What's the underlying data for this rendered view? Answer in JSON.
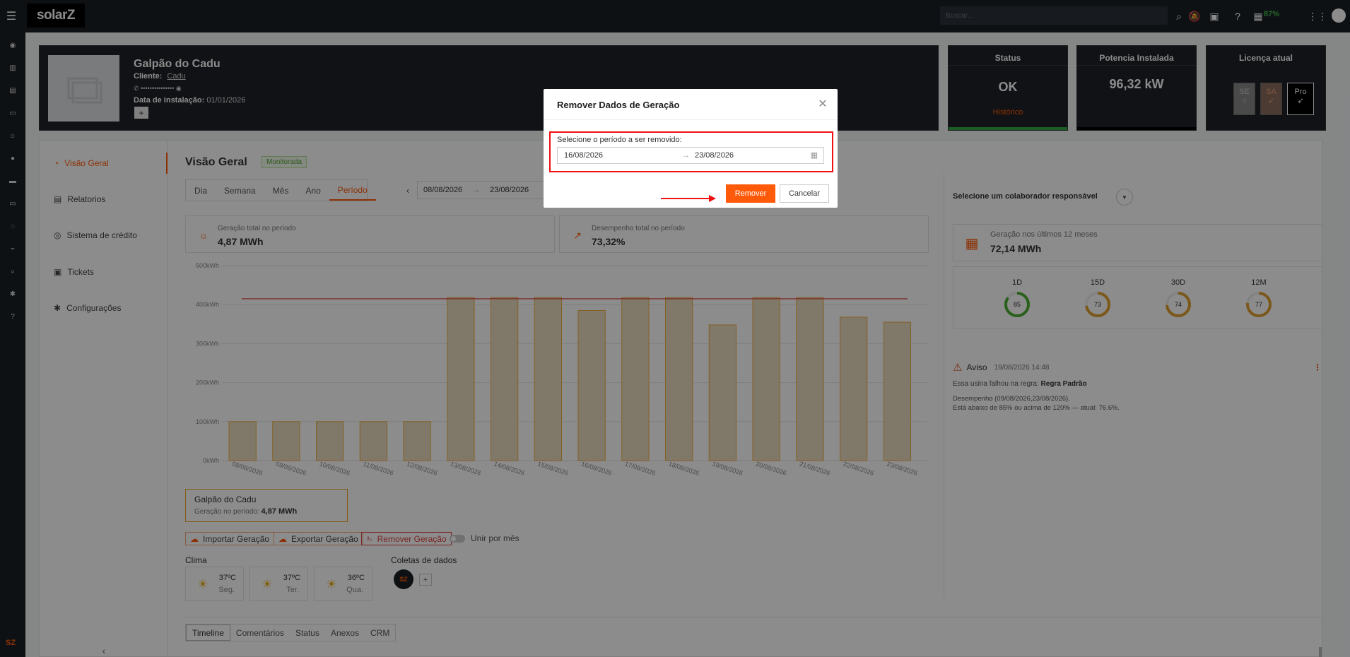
{
  "topbar": {
    "brand": "solarZ",
    "search_placeholder": "Buscar...",
    "battery": "87%"
  },
  "header": {
    "plant_name": "Galpão do Cadu",
    "client_label": "Cliente:",
    "client_name": "Cadu",
    "phone_masked": "•••••••••••••••",
    "install_label": "Data de instalação:",
    "install_date": "01/01/2026",
    "plus": "+"
  },
  "status_card": {
    "title": "Status",
    "value": "OK",
    "link": "Histórico"
  },
  "power_card": {
    "title": "Potencia Instalada",
    "value": "96,32 kW"
  },
  "license_card": {
    "title": "Licença atual",
    "items": [
      "SE",
      "SA",
      "Pro"
    ]
  },
  "nav": {
    "items": [
      {
        "label": "Visão Geral",
        "active": true
      },
      {
        "label": "Relatorios"
      },
      {
        "label": "Sistema de crédito"
      },
      {
        "label": "Tickets"
      },
      {
        "label": "Configurações"
      }
    ]
  },
  "overview": {
    "title": "Visão Geral",
    "badge": "Monitorada",
    "tabs": [
      "Dia",
      "Semana",
      "Mês",
      "Ano",
      "Período"
    ],
    "active_tab": "Período",
    "date_from": "08/08/2026",
    "date_to": "23/08/2026",
    "kpi_total_label": "Geração total no período",
    "kpi_total_value": "4,87 MWh",
    "kpi_perf_label": "Desempenho total no período",
    "kpi_perf_value": "73,32%"
  },
  "chart_data": {
    "type": "bar",
    "categories": [
      "08/08/2026",
      "09/08/2026",
      "10/08/2026",
      "11/08/2026",
      "12/08/2026",
      "13/08/2026",
      "14/08/2026",
      "15/08/2026",
      "16/08/2026",
      "17/08/2026",
      "18/08/2026",
      "19/08/2026",
      "20/08/2026",
      "21/08/2026",
      "22/08/2026",
      "23/08/2026"
    ],
    "values": [
      100,
      100,
      100,
      100,
      100,
      418,
      418,
      418,
      385,
      418,
      418,
      348,
      418,
      418,
      368,
      355
    ],
    "reference_line": 415,
    "yticks": [
      "0kWh",
      "100kWh",
      "200kWh",
      "300kWh",
      "400kWh",
      "500kWh"
    ],
    "ylim": [
      0,
      500
    ],
    "colors": {
      "bar_fill": "#e9dcc0",
      "bar_stroke": "#f0b040",
      "reference": "#e03030"
    }
  },
  "summary": {
    "title": "Galpão do Cadu",
    "label": "Geração no período:",
    "value": "4,87 MWh"
  },
  "actions": {
    "import": "Importar Geração",
    "export": "Exportar Geração",
    "remove": "Remover Geração",
    "merge": "Unir por mês"
  },
  "weather": {
    "title": "Clima",
    "days": [
      {
        "temp": "37ºC",
        "day": "Seg."
      },
      {
        "temp": "37ºC",
        "day": "Ter."
      },
      {
        "temp": "36ºC",
        "day": "Qua."
      }
    ]
  },
  "collections": {
    "title": "Coletas de dados",
    "logo": "SZ",
    "plus": "+"
  },
  "right": {
    "collaborator": "Selecione um colaborador responsável",
    "gen12_label": "Geração nos últimos 12 meses",
    "gen12_value": "72,14 MWh",
    "gauges": [
      {
        "label": "1D",
        "value": "85",
        "color": "#4caf32"
      },
      {
        "label": "15D",
        "value": "73",
        "color": "#e0a030"
      },
      {
        "label": "30D",
        "value": "74",
        "color": "#e0a030"
      },
      {
        "label": "12M",
        "value": "77",
        "color": "#e0a030"
      }
    ],
    "warning_title": "Aviso",
    "warning_date": "19/08/2026 14:48",
    "warning_rule_text": "Essa usina falhou na regra:",
    "warning_rule": "Regra Padrão",
    "warning_perf": "Desempenho (09/08/2026,23/08/2026).",
    "warning_detail": "Está abaixo de 85% ou acima de 120% — atual: 76.6%."
  },
  "bottom_tabs": [
    "Timeline",
    "Comentários",
    "Status",
    "Anexos",
    "CRM"
  ],
  "modal": {
    "title": "Remover Dados de Geração",
    "label": "Selecione o período a ser removido:",
    "from": "16/08/2026",
    "to": "23/08/2026",
    "confirm": "Remover",
    "cancel": "Cancelar"
  },
  "leftbar_logo": "SZ"
}
